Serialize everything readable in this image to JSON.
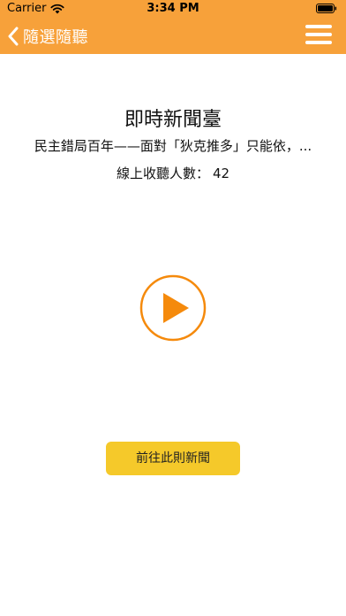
{
  "status_bar": {
    "carrier": "Carrier",
    "time": "3:34 PM",
    "wifi_icon": "wifi-icon",
    "battery_icon": "battery-icon"
  },
  "nav": {
    "back_label": "隨選隨聽",
    "back_icon": "chevron-left-icon",
    "menu_icon": "hamburger-menu-icon"
  },
  "content": {
    "title": "即時新聞臺",
    "headline": "民主錯局百年——面對「狄克推多」只能依，...",
    "listeners_label": "線上收聽人數：",
    "listeners_count": "42",
    "play_icon": "play-icon",
    "go_news_label": "前往此則新聞"
  },
  "colors": {
    "header_orange": "#f7a13a",
    "button_yellow": "#f5c92a",
    "play_orange": "#f58a0c"
  }
}
